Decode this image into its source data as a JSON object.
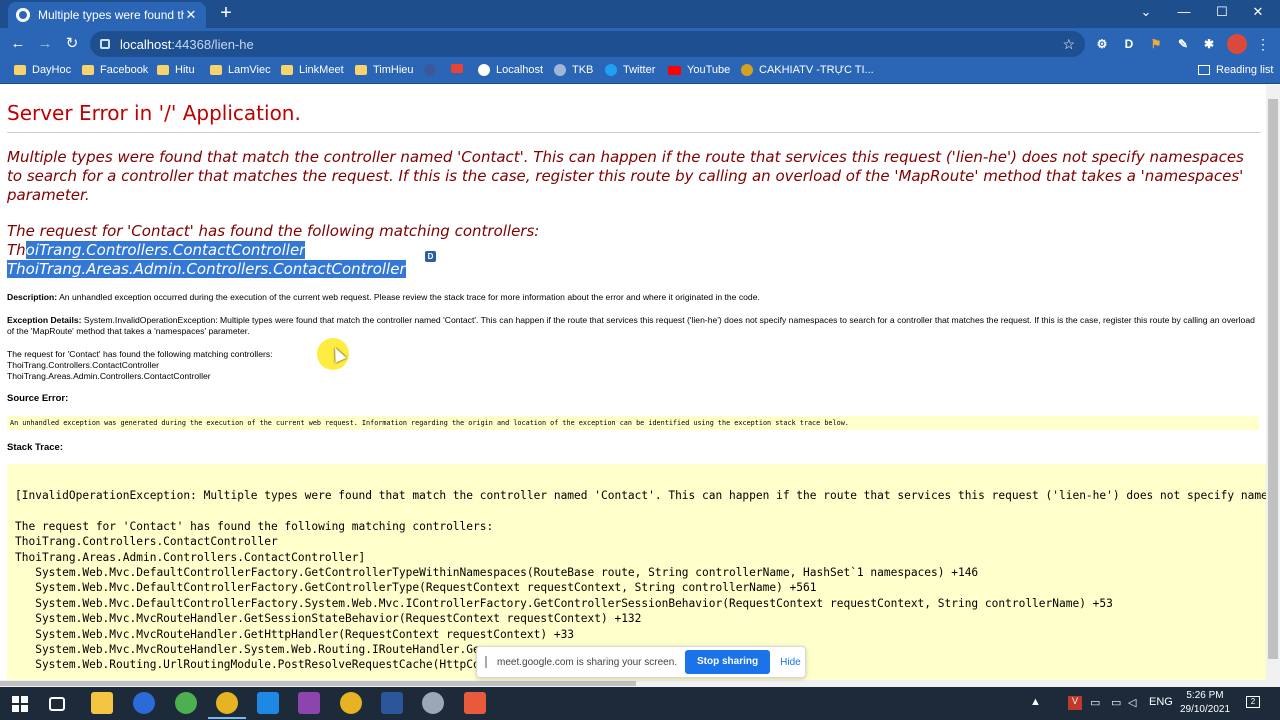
{
  "browser": {
    "tab_title": "Multiple types were found that m",
    "url_host": "localhost",
    "url_path": ":44368/lien-he",
    "bookmarks": [
      "DayHoc",
      "Facebook",
      "Hitu",
      "LamViec",
      "LinkMeet",
      "TimHieu",
      "Localhost",
      "TKB",
      "Twitter",
      "YouTube",
      "CAKHIATV -TRỰC TI..."
    ],
    "reading_list": "Reading list",
    "ext_letter": "D"
  },
  "page": {
    "heading": "Server Error in '/' Application.",
    "message": "Multiple types were found that match the controller named 'Contact'. This can happen if the route that services this request ('lien-he') does not specify namespaces to search for a controller that matches the request. If this is the case, register this route by calling an overload of the 'MapRoute' method that takes a 'namespaces' parameter.",
    "request_intro": "The request for 'Contact' has found the following matching controllers:",
    "controller1_prefix": "Th",
    "controller1_selected": "oiTrang.Controllers.ContactController",
    "controller2": "ThoiTrang.Areas.Admin.Controllers.ContactController",
    "badge": "D",
    "description_label": "Description:",
    "description_text": "An unhandled exception occurred during the execution of the current web request. Please review the stack trace for more information about the error and where it originated in the code.",
    "exception_label": "Exception Details:",
    "exception_text": "System.InvalidOperationException: Multiple types were found that match the controller named 'Contact'. This can happen if the route that services this request ('lien-he') does not specify namespaces to search for a controller that matches the request. If this is the case, register this route by calling an overload of the 'MapRoute' method that takes a 'namespaces' parameter.",
    "small_request_intro": "The request for 'Contact' has found the following matching controllers:",
    "small_controller1": "ThoiTrang.Controllers.ContactController",
    "small_controller2": "ThoiTrang.Areas.Admin.Controllers.ContactController",
    "source_error_label": "Source Error:",
    "source_error_text": "An unhandled exception was generated during the execution of the current web request. Information regarding the origin and location of the exception can be identified using the exception stack trace below.",
    "stack_trace_label": "Stack Trace:",
    "stack_trace": "[InvalidOperationException: Multiple types were found that match the controller named 'Contact'. This can happen if the route that services this request ('lien-he') does not specify name\n\nThe request for 'Contact' has found the following matching controllers:\nThoiTrang.Controllers.ContactController\nThoiTrang.Areas.Admin.Controllers.ContactController]\n   System.Web.Mvc.DefaultControllerFactory.GetControllerTypeWithinNamespaces(RouteBase route, String controllerName, HashSet`1 namespaces) +146\n   System.Web.Mvc.DefaultControllerFactory.GetControllerType(RequestContext requestContext, String controllerName) +561\n   System.Web.Mvc.DefaultControllerFactory.System.Web.Mvc.IControllerFactory.GetControllerSessionBehavior(RequestContext requestContext, String controllerName) +53\n   System.Web.Mvc.MvcRouteHandler.GetSessionStateBehavior(RequestContext requestContext) +132\n   System.Web.Mvc.MvcRouteHandler.GetHttpHandler(RequestContext requestContext) +33\n   System.Web.Mvc.MvcRouteHandler.System.Web.Routing.IRouteHandler.Ge\n   System.Web.Routing.UrlRoutingModule.PostResolveRequestCache(HttpCo"
  },
  "sharebar": {
    "text": "meet.google.com is sharing your screen.",
    "stop": "Stop sharing",
    "hide": "Hide"
  },
  "taskbar": {
    "lang": "ENG",
    "time": "5:26 PM",
    "date": "29/10/2021",
    "notif_count": "2"
  },
  "colors": {
    "error_red": "#c00000",
    "message_maroon": "#800000",
    "selection": "#3478d6",
    "code_bg": "#ffffcc",
    "chrome_blue": "#2a66b5"
  }
}
